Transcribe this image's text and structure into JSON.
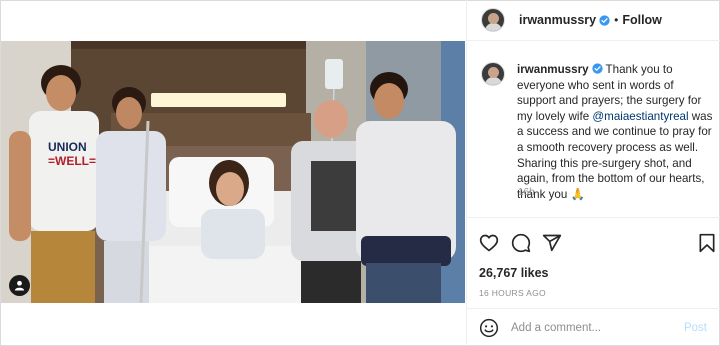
{
  "header": {
    "username": "irwanmussry",
    "separator": "•",
    "follow_label": "Follow"
  },
  "caption": {
    "username": "irwanmussry",
    "text_before_mention": " Thank you to everyone who sent in words of support and prayers; the surgery for my lovely wife ",
    "mention": "@maiaestiantyreal",
    "text_after_mention": " was a success and we continue to pray for a smooth recovery process as well. Sharing this pre-surgery shot, and again, from the bottom of our hearts, thank you ",
    "emoji": "🙏",
    "relative_time": "16h"
  },
  "stats": {
    "likes": "26,767 likes",
    "time": "16 HOURS AGO"
  },
  "comment": {
    "placeholder": "Add a comment...",
    "post_label": "Post"
  },
  "photo": {
    "shirt_text_line1": "UNION",
    "shirt_text_line2": "=WELL="
  },
  "colors": {
    "verified": "#3897f0",
    "mention": "#00376b",
    "post_disabled": "#b2dffc",
    "secondary_text": "#8e8e8e"
  },
  "icons": [
    "verified-badge-icon",
    "heart-icon",
    "comment-icon",
    "share-icon",
    "bookmark-icon",
    "emoji-icon",
    "user-tag-icon"
  ]
}
